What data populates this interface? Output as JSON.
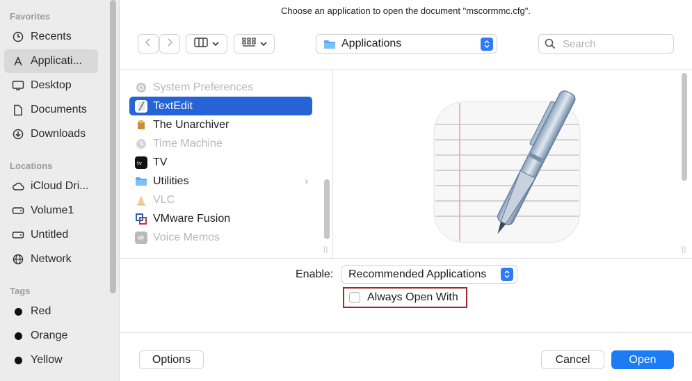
{
  "dialog": {
    "title": "Choose an application to open the document \"mscormmc.cfg\"."
  },
  "sidebar": {
    "favorites_header": "Favorites",
    "favorites": [
      {
        "label": "Recents",
        "icon": "clock-icon"
      },
      {
        "label": "Applicati...",
        "icon": "applications-icon"
      },
      {
        "label": "Desktop",
        "icon": "desktop-icon"
      },
      {
        "label": "Documents",
        "icon": "document-icon"
      },
      {
        "label": "Downloads",
        "icon": "download-icon"
      }
    ],
    "locations_header": "Locations",
    "locations": [
      {
        "label": "iCloud Dri...",
        "icon": "cloud-icon"
      },
      {
        "label": "Volume1",
        "icon": "drive-icon"
      },
      {
        "label": "Untitled",
        "icon": "drive-icon"
      },
      {
        "label": "Network",
        "icon": "globe-icon"
      }
    ],
    "tags_header": "Tags",
    "tags": [
      {
        "label": "Red",
        "color": "#111111"
      },
      {
        "label": "Orange",
        "color": "#111111"
      },
      {
        "label": "Yellow",
        "color": "#111111"
      }
    ]
  },
  "toolbar": {
    "location": "Applications",
    "search_placeholder": "Search"
  },
  "file_list": [
    {
      "label": "System Preferences",
      "state": "dim",
      "icon": "gear-icon"
    },
    {
      "label": "TextEdit",
      "state": "selected",
      "icon": "textedit-icon"
    },
    {
      "label": "The Unarchiver",
      "state": "normal",
      "icon": "unarchiver-icon"
    },
    {
      "label": "Time Machine",
      "state": "dim",
      "icon": "time-machine-icon"
    },
    {
      "label": "TV",
      "state": "normal",
      "icon": "tv-icon"
    },
    {
      "label": "Utilities",
      "state": "normal",
      "icon": "folder-icon",
      "has_children": true
    },
    {
      "label": "VLC",
      "state": "dim",
      "icon": "vlc-icon"
    },
    {
      "label": "VMware Fusion",
      "state": "normal",
      "icon": "vmware-icon"
    },
    {
      "label": "Voice Memos",
      "state": "dim",
      "icon": "voice-memos-icon"
    }
  ],
  "options": {
    "enable_label": "Enable:",
    "enable_value": "Recommended Applications",
    "always_open_label": "Always Open With"
  },
  "buttons": {
    "options": "Options",
    "cancel": "Cancel",
    "open": "Open"
  },
  "colors": {
    "accent": "#2563d6",
    "highlight_border": "#a3262b"
  }
}
